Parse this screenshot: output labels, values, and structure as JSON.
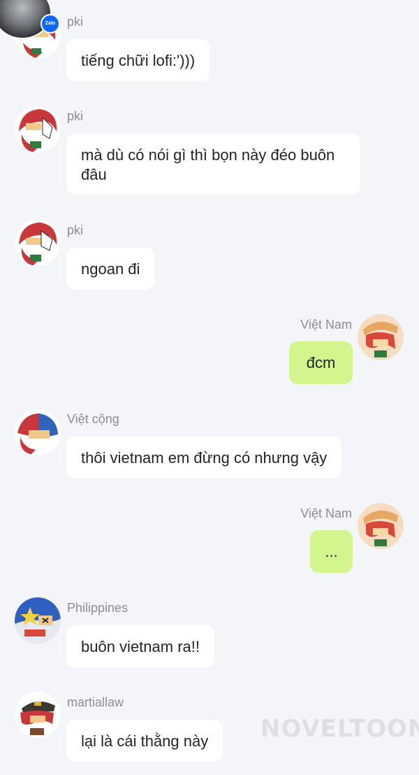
{
  "app": {
    "badge_label": "Zalo",
    "watermark": "NOVELTOON"
  },
  "messages": [
    {
      "sender": "pki",
      "text": "tiếng chữi lofi:')))",
      "direction": "incoming",
      "avatar": "pki-avatar-icon"
    },
    {
      "sender": "pki",
      "text": "mà dù có nói gì thì bọn này đéo buôn đâu",
      "direction": "incoming",
      "avatar": "pki-avatar-icon"
    },
    {
      "sender": "pki",
      "text": "ngoan đi",
      "direction": "incoming",
      "avatar": "pki-avatar-icon"
    },
    {
      "sender": "Việt Nam",
      "text": "đcm",
      "direction": "outgoing",
      "avatar": "viet-nam-avatar-icon"
    },
    {
      "sender": "Việt cộng",
      "text": "thôi vietnam em đừng có nhưng vậy",
      "direction": "incoming",
      "avatar": "viet-cong-avatar-icon"
    },
    {
      "sender": "Việt Nam",
      "text": "...",
      "direction": "outgoing",
      "avatar": "viet-nam-avatar-icon"
    },
    {
      "sender": "Philippines",
      "text": "buôn vietnam ra!!",
      "direction": "incoming",
      "avatar": "philippines-avatar-icon"
    },
    {
      "sender": "martiallaw",
      "text": "lại là cái thằng này",
      "direction": "incoming",
      "avatar": "martiallaw-avatar-icon"
    }
  ],
  "colors": {
    "background": "#f3f5f8",
    "incoming_bubble": "#ffffff",
    "outgoing_bubble": "#d3f58e",
    "sender_name": "#8a8d91"
  }
}
